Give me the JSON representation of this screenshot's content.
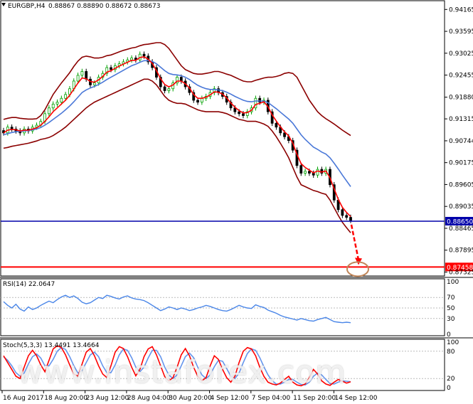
{
  "header": {
    "symbol": "EURGBP,H4",
    "ohlc": "0.88867 0.88890 0.88672 0.88673"
  },
  "watermark": "www.instaforex.com",
  "colors": {
    "bull": "#00a000",
    "bear": "#000000",
    "bollinger": "#8b0000",
    "ma_fast": "#ff0000",
    "ma_slow": "#4a78d8",
    "support_line": "#0000aa",
    "target_line": "#ff0000",
    "target_circle": "#c0865a",
    "rsi": "#4a86e8",
    "stoch_main": "#ff0000",
    "stoch_signal": "#6495ed"
  },
  "chart_data": [
    {
      "type": "line",
      "panel": "price",
      "x_labels": [
        "16 Aug 2017",
        "18 Aug 20:00",
        "23 Aug 12:00",
        "28 Aug 04:00",
        "30 Aug 20:00",
        "4 Sep 12:00",
        "7 Sep 04:00",
        "11 Sep 20:00",
        "14 Sep 12:00"
      ],
      "y_ticks": [
        "0.94165",
        "0.93595",
        "0.93025",
        "0.92455",
        "0.91880",
        "0.91315",
        "0.90744",
        "0.90175",
        "0.89605",
        "0.89035",
        "0.88465",
        "0.87895",
        "0.87325"
      ],
      "ylim": [
        0.8726,
        0.943
      ],
      "bars": 85,
      "series": [
        {
          "key": "close",
          "values": [
            0.9095,
            0.911,
            0.9105,
            0.91,
            0.9095,
            0.9105,
            0.91,
            0.911,
            0.9115,
            0.9125,
            0.9145,
            0.916,
            0.917,
            0.9175,
            0.9185,
            0.9195,
            0.921,
            0.923,
            0.9245,
            0.9255,
            0.9235,
            0.922,
            0.9225,
            0.924,
            0.925,
            0.9265,
            0.926,
            0.927,
            0.9275,
            0.928,
            0.9285,
            0.929,
            0.9285,
            0.93,
            0.9295,
            0.928,
            0.9265,
            0.924,
            0.9215,
            0.9205,
            0.921,
            0.9225,
            0.924,
            0.923,
            0.9215,
            0.92,
            0.918,
            0.9175,
            0.9185,
            0.919,
            0.92,
            0.921,
            0.92,
            0.919,
            0.9175,
            0.916,
            0.915,
            0.9145,
            0.914,
            0.915,
            0.916,
            0.9185,
            0.9175,
            0.918,
            0.915,
            0.912,
            0.911,
            0.9095,
            0.9085,
            0.9075,
            0.905,
            0.901,
            0.899,
            0.8995,
            0.899,
            0.8985,
            0.9,
            0.899,
            0.9,
            0.896,
            0.892,
            0.8895,
            0.888,
            0.8875,
            0.8867
          ]
        },
        {
          "key": "ma_fast",
          "values": [
            0.9095,
            0.9102,
            0.9104,
            0.9103,
            0.91,
            0.9102,
            0.9102,
            0.9105,
            0.9108,
            0.9115,
            0.9125,
            0.9137,
            0.915,
            0.916,
            0.917,
            0.918,
            0.9193,
            0.9209,
            0.9225,
            0.9238,
            0.9236,
            0.9229,
            0.9227,
            0.9233,
            0.9242,
            0.9253,
            0.9257,
            0.9263,
            0.9269,
            0.9274,
            0.9279,
            0.9284,
            0.9284,
            0.9291,
            0.9293,
            0.9287,
            0.9276,
            0.9257,
            0.9236,
            0.9221,
            0.9215,
            0.922,
            0.923,
            0.923,
            0.9223,
            0.9212,
            0.9195,
            0.9185,
            0.9185,
            0.9188,
            0.9194,
            0.9202,
            0.9201,
            0.9196,
            0.9186,
            0.9173,
            0.9162,
            0.9153,
            0.9147,
            0.9148,
            0.9154,
            0.9169,
            0.9172,
            0.9176,
            0.9163,
            0.9142,
            0.9126,
            0.9111,
            0.9098,
            0.9087,
            0.9068,
            0.9039,
            0.9015,
            0.9005,
            0.8998,
            0.8991,
            0.8996,
            0.8993,
            0.8996,
            0.8978,
            0.8949,
            0.8922,
            0.8901,
            0.8888,
            0.8877
          ]
        },
        {
          "key": "ma_slow",
          "values": [
            0.909,
            0.9093,
            0.9096,
            0.9098,
            0.9099,
            0.91,
            0.9101,
            0.9103,
            0.9105,
            0.9109,
            0.9115,
            0.9122,
            0.913,
            0.9138,
            0.9146,
            0.9155,
            0.9165,
            0.9176,
            0.9188,
            0.92,
            0.9207,
            0.9212,
            0.9216,
            0.9221,
            0.9227,
            0.9234,
            0.924,
            0.9246,
            0.9252,
            0.9258,
            0.9264,
            0.927,
            0.9274,
            0.9279,
            0.9283,
            0.9283,
            0.9281,
            0.9275,
            0.9266,
            0.9257,
            0.925,
            0.9247,
            0.9246,
            0.9244,
            0.924,
            0.9234,
            0.9226,
            0.9219,
            0.9214,
            0.921,
            0.9208,
            0.9208,
            0.9207,
            0.9205,
            0.9201,
            0.9196,
            0.919,
            0.9185,
            0.918,
            0.9177,
            0.9176,
            0.9178,
            0.9178,
            0.9178,
            0.9174,
            0.9166,
            0.9158,
            0.9149,
            0.914,
            0.9131,
            0.912,
            0.9105,
            0.909,
            0.9078,
            0.9068,
            0.9058,
            0.9052,
            0.9045,
            0.904,
            0.903,
            0.9016,
            0.9001,
            0.8985,
            0.897,
            0.8955
          ]
        },
        {
          "key": "bb_upper",
          "values": [
            0.913,
            0.9133,
            0.9135,
            0.9135,
            0.9133,
            0.9132,
            0.9131,
            0.9131,
            0.9132,
            0.914,
            0.9155,
            0.9175,
            0.9195,
            0.921,
            0.9225,
            0.9238,
            0.9252,
            0.9268,
            0.9282,
            0.9292,
            0.9295,
            0.9293,
            0.929,
            0.929,
            0.9292,
            0.9296,
            0.9298,
            0.9302,
            0.9306,
            0.931,
            0.9313,
            0.9316,
            0.9318,
            0.9322,
            0.9325,
            0.9326,
            0.9328,
            0.933,
            0.933,
            0.9325,
            0.9315,
            0.93,
            0.9285,
            0.927,
            0.926,
            0.9255,
            0.925,
            0.9248,
            0.9248,
            0.925,
            0.9252,
            0.9255,
            0.9255,
            0.9252,
            0.9248,
            0.9245,
            0.924,
            0.9235,
            0.923,
            0.9228,
            0.9228,
            0.9232,
            0.9235,
            0.9238,
            0.924,
            0.924,
            0.9242,
            0.9245,
            0.925,
            0.9252,
            0.925,
            0.924,
            0.922,
            0.92,
            0.918,
            0.9165,
            0.915,
            0.914,
            0.9132,
            0.9125,
            0.9118,
            0.911,
            0.9102,
            0.9095,
            0.9088
          ]
        },
        {
          "key": "bb_lower",
          "values": [
            0.9055,
            0.9057,
            0.906,
            0.9062,
            0.9064,
            0.9066,
            0.9068,
            0.9071,
            0.9074,
            0.9078,
            0.908,
            0.9083,
            0.9088,
            0.9095,
            0.9102,
            0.911,
            0.912,
            0.913,
            0.914,
            0.915,
            0.916,
            0.9168,
            0.9175,
            0.918,
            0.9185,
            0.919,
            0.9195,
            0.92,
            0.9205,
            0.921,
            0.9215,
            0.922,
            0.9225,
            0.923,
            0.9235,
            0.9235,
            0.923,
            0.922,
            0.9205,
            0.919,
            0.918,
            0.9175,
            0.9172,
            0.9172,
            0.917,
            0.9165,
            0.916,
            0.9155,
            0.9152,
            0.915,
            0.915,
            0.915,
            0.915,
            0.9148,
            0.9145,
            0.914,
            0.9135,
            0.913,
            0.9128,
            0.9125,
            0.9125,
            0.9125,
            0.9122,
            0.9118,
            0.9112,
            0.91,
            0.9085,
            0.9068,
            0.905,
            0.903,
            0.9005,
            0.898,
            0.896,
            0.8955,
            0.895,
            0.8945,
            0.8942,
            0.8938,
            0.8935,
            0.892,
            0.89,
            0.888,
            0.8862,
            0.8848,
            0.8835
          ]
        }
      ],
      "hlines": [
        {
          "key": "support",
          "value": 0.8865,
          "label": "0.88650"
        },
        {
          "key": "target",
          "value": 0.87458,
          "label": "0.87458"
        }
      ]
    },
    {
      "type": "line",
      "panel": "rsi",
      "title": "RSI(14) 22.0647",
      "y_ticks": [
        "100",
        "70",
        "50",
        "30",
        "0"
      ],
      "ylim": [
        0,
        100
      ],
      "values": [
        62,
        55,
        50,
        57,
        48,
        44,
        52,
        47,
        50,
        55,
        59,
        63,
        60,
        66,
        71,
        74,
        70,
        73,
        68,
        61,
        58,
        60,
        65,
        70,
        68,
        74,
        72,
        69,
        67,
        71,
        73,
        69,
        67,
        66,
        64,
        60,
        55,
        50,
        45,
        48,
        52,
        50,
        47,
        50,
        48,
        45,
        47,
        50,
        52,
        55,
        53,
        50,
        47,
        45,
        44,
        47,
        51,
        55,
        52,
        50,
        49,
        56,
        53,
        51,
        46,
        43,
        40,
        36,
        33,
        31,
        29,
        27,
        30,
        28,
        26,
        25,
        28,
        30,
        32,
        28,
        24,
        23,
        22,
        23,
        22
      ]
    },
    {
      "type": "line",
      "panel": "stoch",
      "title": "Stoch(5,3,3) 13.4491 13.4664",
      "y_ticks": [
        "100",
        "80",
        "20",
        "0"
      ],
      "ylim": [
        0,
        100
      ],
      "series": [
        {
          "key": "main",
          "values": [
            70,
            55,
            40,
            25,
            20,
            45,
            70,
            82,
            70,
            50,
            35,
            60,
            85,
            92,
            88,
            72,
            50,
            30,
            25,
            52,
            78,
            86,
            70,
            48,
            30,
            22,
            48,
            78,
            90,
            86,
            68,
            45,
            26,
            40,
            68,
            85,
            90,
            72,
            48,
            24,
            15,
            22,
            45,
            72,
            86,
            70,
            45,
            25,
            15,
            22,
            48,
            70,
            62,
            40,
            22,
            12,
            25,
            55,
            80,
            88,
            85,
            70,
            45,
            25,
            12,
            8,
            6,
            10,
            18,
            25,
            12,
            6,
            4,
            8,
            22,
            40,
            30,
            15,
            8,
            5,
            12,
            18,
            14,
            10,
            13
          ]
        },
        {
          "key": "signal",
          "values": [
            68,
            60,
            48,
            33,
            25,
            32,
            52,
            68,
            74,
            65,
            48,
            48,
            62,
            80,
            88,
            84,
            68,
            48,
            32,
            38,
            55,
            72,
            78,
            68,
            48,
            33,
            33,
            50,
            72,
            85,
            82,
            66,
            45,
            35,
            45,
            65,
            82,
            82,
            68,
            45,
            28,
            20,
            28,
            48,
            68,
            76,
            66,
            45,
            28,
            20,
            28,
            46,
            60,
            58,
            42,
            25,
            20,
            32,
            55,
            75,
            85,
            82,
            66,
            46,
            28,
            15,
            8,
            8,
            12,
            18,
            18,
            12,
            7,
            6,
            12,
            25,
            32,
            28,
            18,
            9,
            8,
            12,
            15,
            14,
            13
          ]
        }
      ]
    }
  ]
}
